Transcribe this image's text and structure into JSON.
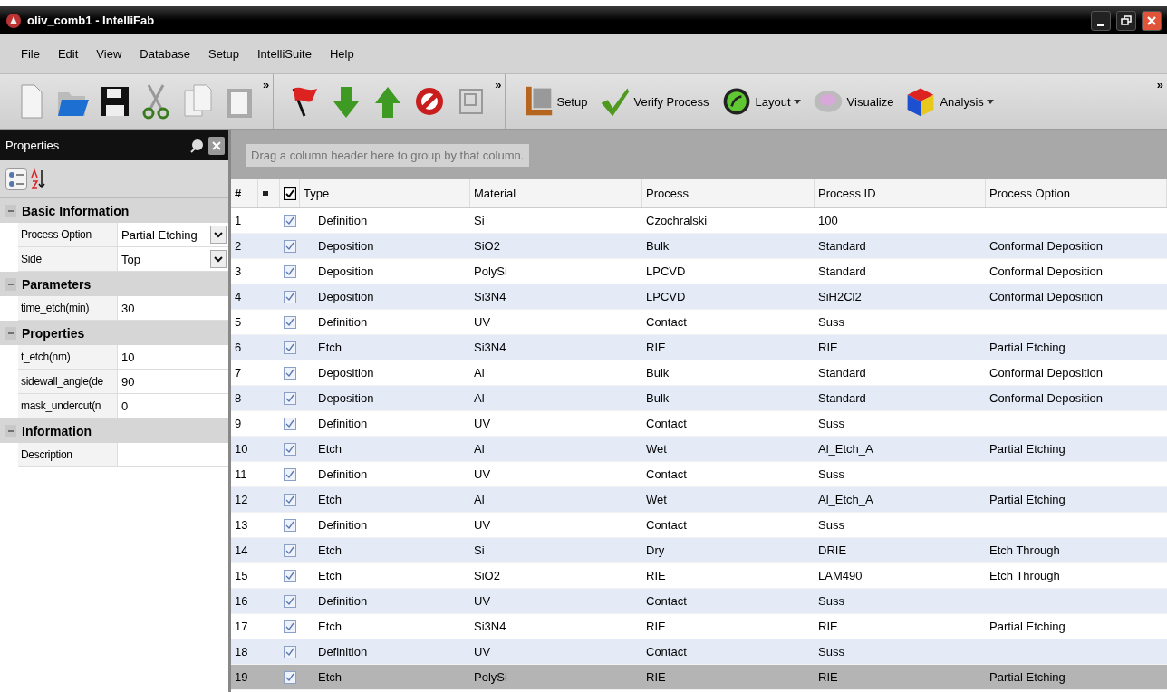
{
  "window": {
    "title": "oliv_comb1 - IntelliFab"
  },
  "menu": [
    "File",
    "Edit",
    "View",
    "Database",
    "Setup",
    "IntelliSuite",
    "Help"
  ],
  "toolbar_main": {
    "overflow": "»"
  },
  "toolbar_edit": {
    "overflow": "»"
  },
  "toolbar_tools": {
    "overflow": "»",
    "buttons": [
      {
        "label": "Setup",
        "dropdown": false
      },
      {
        "label": "Verify Process",
        "dropdown": false
      },
      {
        "label": "Layout",
        "dropdown": true
      },
      {
        "label": "Visualize",
        "dropdown": false
      },
      {
        "label": "Analysis",
        "dropdown": true
      }
    ]
  },
  "properties": {
    "title": "Properties",
    "sections": [
      {
        "title": "Basic Information",
        "expanded": true,
        "items": [
          {
            "name": "Process Option",
            "value": "Partial Etching",
            "kind": "dropdown"
          },
          {
            "name": "Side",
            "value": "Top",
            "kind": "dropdown"
          }
        ]
      },
      {
        "title": "Parameters",
        "expanded": true,
        "items": [
          {
            "name": "time_etch(min)",
            "value": "30",
            "kind": "text"
          }
        ]
      },
      {
        "title": "Properties",
        "expanded": true,
        "items": [
          {
            "name": "t_etch(nm)",
            "value": "10",
            "kind": "text"
          },
          {
            "name": "sidewall_angle(de",
            "value": "90",
            "kind": "text"
          },
          {
            "name": "mask_undercut(n",
            "value": "0",
            "kind": "text"
          }
        ]
      },
      {
        "title": "Information",
        "expanded": true,
        "items": [
          {
            "name": "Description",
            "kind": "text"
          }
        ]
      }
    ]
  },
  "grid": {
    "group_hint": "Drag a column header here to group by that column.",
    "columns": [
      "#",
      "Type",
      "Material",
      "Process",
      "Process ID",
      "Process Option"
    ],
    "all_checked": true,
    "rows": [
      {
        "checked": true,
        "selected": false,
        "cells": [
          "1",
          "Definition",
          "Si",
          "Czochralski",
          "100"
        ]
      },
      {
        "checked": true,
        "selected": false,
        "cells": [
          "2",
          "Deposition",
          "SiO2",
          "Bulk",
          "Standard",
          "Conformal Deposition"
        ]
      },
      {
        "checked": true,
        "selected": false,
        "cells": [
          "3",
          "Deposition",
          "PolySi",
          "LPCVD",
          "Standard",
          "Conformal Deposition"
        ]
      },
      {
        "checked": true,
        "selected": false,
        "cells": [
          "4",
          "Deposition",
          "Si3N4",
          "LPCVD",
          "SiH2Cl2",
          "Conformal Deposition"
        ]
      },
      {
        "checked": true,
        "selected": false,
        "cells": [
          "5",
          "Definition",
          "UV",
          "Contact",
          "Suss"
        ]
      },
      {
        "checked": true,
        "selected": false,
        "cells": [
          "6",
          "Etch",
          "Si3N4",
          "RIE",
          "RIE",
          "Partial Etching"
        ]
      },
      {
        "checked": true,
        "selected": false,
        "cells": [
          "7",
          "Deposition",
          "Al",
          "Bulk",
          "Standard",
          "Conformal Deposition"
        ]
      },
      {
        "checked": true,
        "selected": false,
        "cells": [
          "8",
          "Deposition",
          "Al",
          "Bulk",
          "Standard",
          "Conformal Deposition"
        ]
      },
      {
        "checked": true,
        "selected": false,
        "cells": [
          "9",
          "Definition",
          "UV",
          "Contact",
          "Suss"
        ]
      },
      {
        "checked": true,
        "selected": false,
        "cells": [
          "10",
          "Etch",
          "Al",
          "Wet",
          "Al_Etch_A",
          "Partial Etching"
        ]
      },
      {
        "checked": true,
        "selected": false,
        "cells": [
          "11",
          "Definition",
          "UV",
          "Contact",
          "Suss"
        ]
      },
      {
        "checked": true,
        "selected": false,
        "cells": [
          "12",
          "Etch",
          "Al",
          "Wet",
          "Al_Etch_A",
          "Partial Etching"
        ]
      },
      {
        "checked": true,
        "selected": false,
        "cells": [
          "13",
          "Definition",
          "UV",
          "Contact",
          "Suss"
        ]
      },
      {
        "checked": true,
        "selected": false,
        "cells": [
          "14",
          "Etch",
          "Si",
          "Dry",
          "DRIE",
          "Etch Through"
        ]
      },
      {
        "checked": true,
        "selected": false,
        "cells": [
          "15",
          "Etch",
          "SiO2",
          "RIE",
          "LAM490",
          "Etch Through"
        ]
      },
      {
        "checked": true,
        "selected": false,
        "cells": [
          "16",
          "Definition",
          "UV",
          "Contact",
          "Suss"
        ]
      },
      {
        "checked": true,
        "selected": false,
        "cells": [
          "17",
          "Etch",
          "Si3N4",
          "RIE",
          "RIE",
          "Partial Etching"
        ]
      },
      {
        "checked": true,
        "selected": false,
        "cells": [
          "18",
          "Definition",
          "UV",
          "Contact",
          "Suss"
        ]
      },
      {
        "checked": true,
        "selected": true,
        "cells": [
          "19",
          "Etch",
          "PolySi",
          "RIE",
          "RIE",
          "Partial Etching"
        ]
      }
    ]
  }
}
